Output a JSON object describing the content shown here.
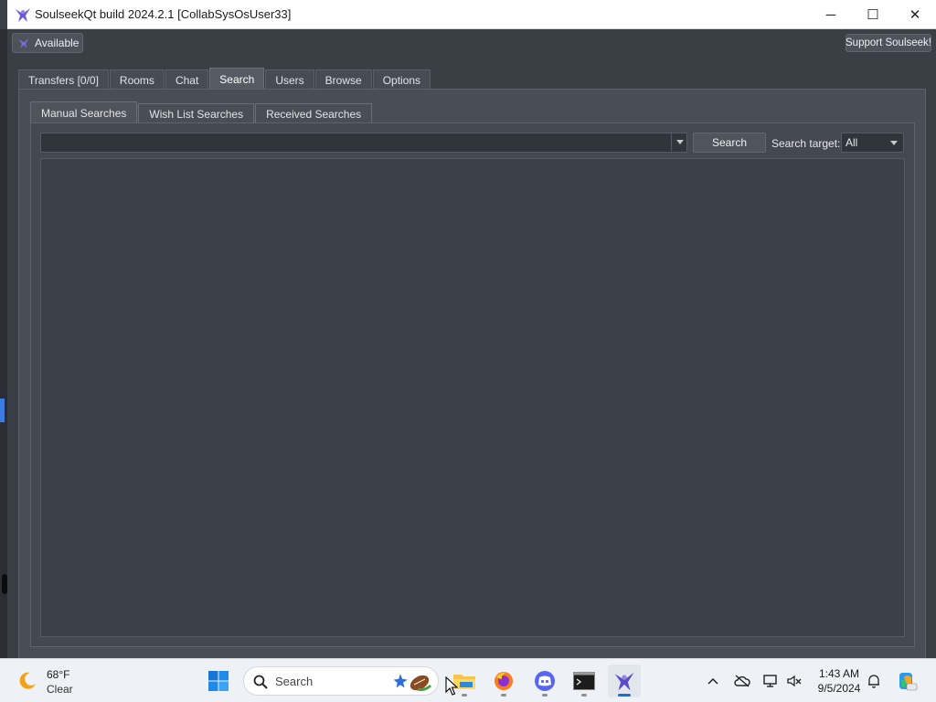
{
  "window": {
    "title": "SoulseekQt build 2024.2.1 [CollabSysOsUser33]",
    "controls": {
      "minimize": "─",
      "maximize": "☐",
      "close": "✕"
    }
  },
  "toolbar": {
    "status_label": "Available",
    "support_label": "Support Soulseek!"
  },
  "main_tabs": [
    {
      "label": "Transfers [0/0]",
      "active": false
    },
    {
      "label": "Rooms",
      "active": false
    },
    {
      "label": "Chat",
      "active": false
    },
    {
      "label": "Search",
      "active": true
    },
    {
      "label": "Users",
      "active": false
    },
    {
      "label": "Browse",
      "active": false
    },
    {
      "label": "Options",
      "active": false
    }
  ],
  "search_tabs": [
    {
      "label": "Manual Searches",
      "active": true
    },
    {
      "label": "Wish List Searches",
      "active": false
    },
    {
      "label": "Received Searches",
      "active": false
    }
  ],
  "search": {
    "query_value": "",
    "button_label": "Search",
    "target_label": "Search target:",
    "target_value": "All"
  },
  "taskbar": {
    "weather": {
      "temp": "68°F",
      "condition": "Clear",
      "icon": "moon-icon"
    },
    "search_placeholder": "Search",
    "apps": [
      "file-explorer",
      "firefox",
      "discord",
      "terminal",
      "soulseek"
    ],
    "clock": {
      "time": "1:43 AM",
      "date": "9/5/2024"
    }
  },
  "colors": {
    "app_background": "#3a3e45",
    "panel": "#494d55",
    "input": "#30343b",
    "taskbar": "#eef1f6",
    "accent": "#1b6fd0"
  }
}
